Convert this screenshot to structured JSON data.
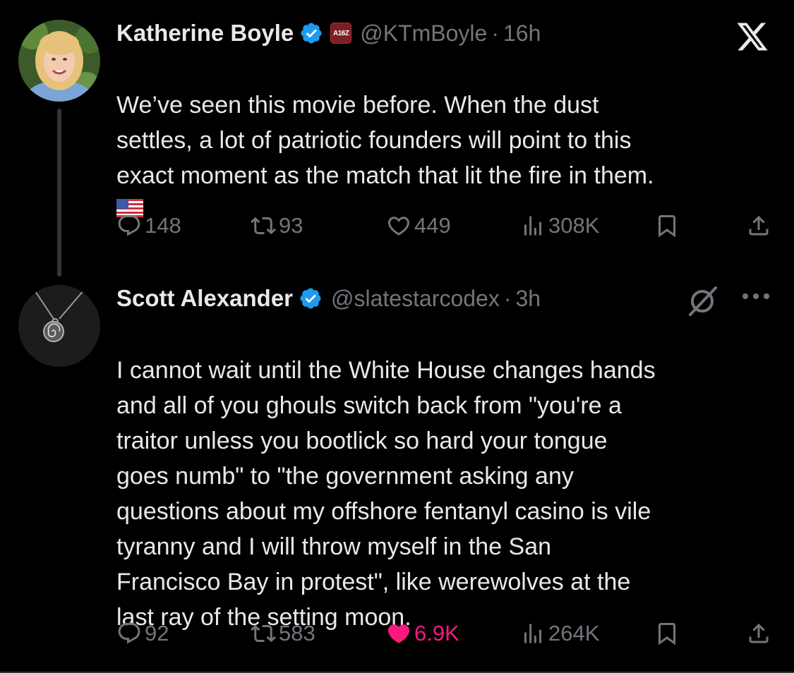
{
  "tweets": [
    {
      "author_name": "Katherine Boyle",
      "affiliation_badge": "A16Z",
      "handle": "@KTmBoyle",
      "separator": "·",
      "time": "16h",
      "text": "We’ve seen this movie before. When the dust\nsettles, a lot of patriotic founders will point to this\nexact moment as the match that lit the fire in them.",
      "emoji": "us-flag-emoji",
      "actions": {
        "replies": "148",
        "reposts": "93",
        "likes": "449",
        "views": "308K"
      }
    },
    {
      "author_name": "Scott Alexander",
      "handle": "@slatestarcodex",
      "separator": "·",
      "time": "3h",
      "text": "I cannot wait until the White House changes hands\nand all of you ghouls switch back from \"you're a\ntraitor unless you bootlick so hard your tongue\ngoes numb\" to \"the government asking any\nquestions about my offshore fentanyl casino is vile\ntyranny and I will throw myself in the San\nFrancisco Bay in protest\", like werewolves at the\nlast ray of the setting moon.",
      "actions": {
        "replies": "92",
        "reposts": "583",
        "likes": "6.9K",
        "views": "264K"
      },
      "liked": true
    }
  ],
  "icons": {
    "brand": "x-logo-icon",
    "verified": "verified-badge-icon",
    "grok": "grok-icon",
    "more": "more-icon",
    "reply": "reply-icon",
    "repost": "repost-icon",
    "like": "heart-icon",
    "views": "views-icon",
    "bookmark": "bookmark-icon",
    "share": "share-icon"
  },
  "colors": {
    "background": "#000000",
    "text": "#e7e9ea",
    "muted": "#71767b",
    "verified": "#1d9bf0",
    "like_active": "#f91880",
    "thread_line": "#333639"
  }
}
